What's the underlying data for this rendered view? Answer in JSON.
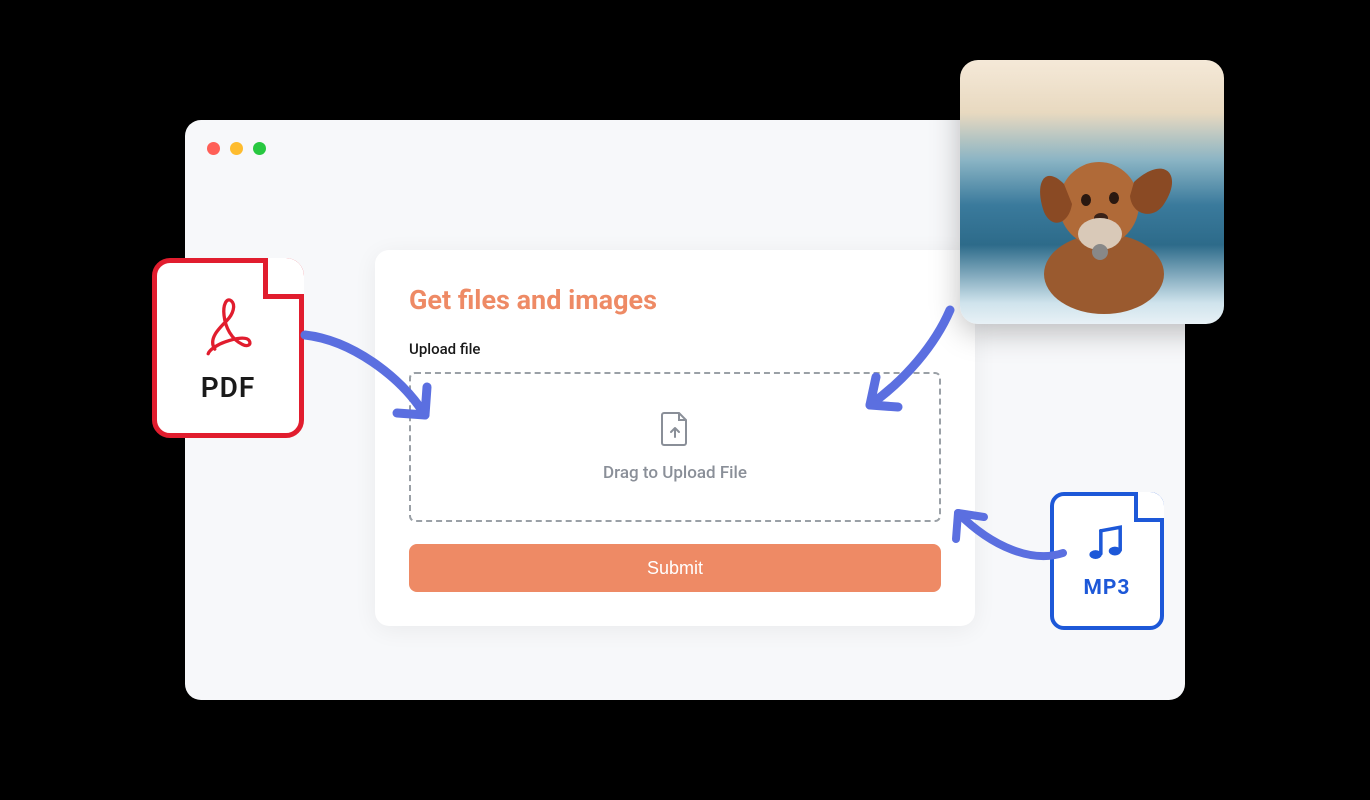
{
  "card": {
    "title": "Get files and images",
    "field_label": "Upload file",
    "dropzone_text": "Drag to Upload File",
    "submit_label": "Submit"
  },
  "tiles": {
    "pdf_label": "PDF",
    "mp3_label": "MP3"
  },
  "icons": {
    "pdf": "pdf-file-icon",
    "mp3": "music-note-icon",
    "upload": "file-upload-icon",
    "image": "dog-photo"
  },
  "colors": {
    "accent": "#ee8a65",
    "pdf_border": "#e11d2e",
    "mp3_border": "#1d58d8",
    "arrow": "#5b6fe0"
  }
}
